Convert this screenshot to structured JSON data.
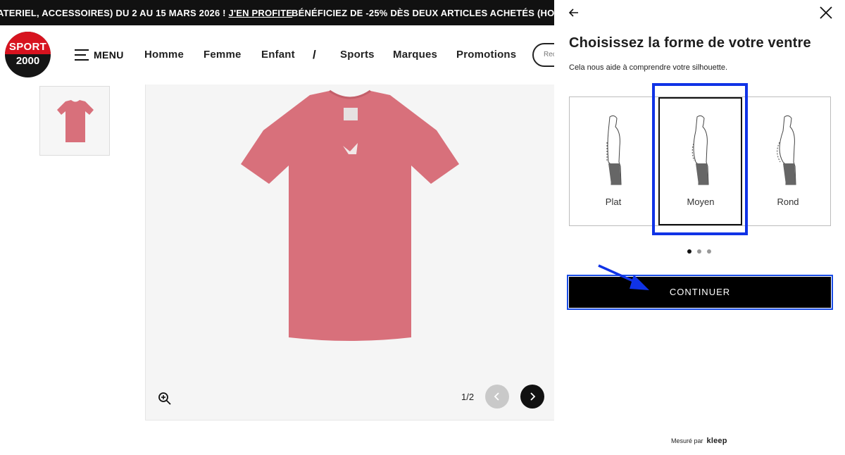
{
  "promo": {
    "message_1": "ATERIEL, ACCESSOIRES) DU 2 AU 15 MARS 2026 ! ",
    "cta_1": "J'EN PROFITE",
    "message_2": "BÉNÉFICIEZ DE -25% DÈS DEUX ARTICLES ACHETÉS (HORS PROMOT"
  },
  "logo": {
    "line1": "SPORT",
    "line2": "2000",
    "colors": {
      "red": "#d7131f",
      "dark": "#151515"
    }
  },
  "header": {
    "menu_label": "MENU",
    "nav": [
      "Homme",
      "Femme",
      "Enfant",
      "Sports",
      "Marques",
      "Promotions"
    ],
    "separator": "/",
    "search_placeholder": "Rec"
  },
  "product": {
    "image_counter": "1/2",
    "tee_color": "#d8707b",
    "icons": [
      "zoom-in-icon",
      "chevron-left-icon",
      "chevron-right-icon"
    ]
  },
  "modal": {
    "title": "Choisissez la forme de votre ventre",
    "subtitle": "Cela nous aide à comprendre votre silhouette.",
    "options": [
      {
        "label": "Plat",
        "selected": false
      },
      {
        "label": "Moyen",
        "selected": true
      },
      {
        "label": "Rond",
        "selected": false
      }
    ],
    "pagination": {
      "pages": 3,
      "current": 1
    },
    "continue_label": "CONTINUER",
    "measured_by": "Mesuré par",
    "brand": "kleep",
    "icons": [
      "arrow-left-icon",
      "close-icon"
    ]
  },
  "annotation_color": "#1033e6"
}
